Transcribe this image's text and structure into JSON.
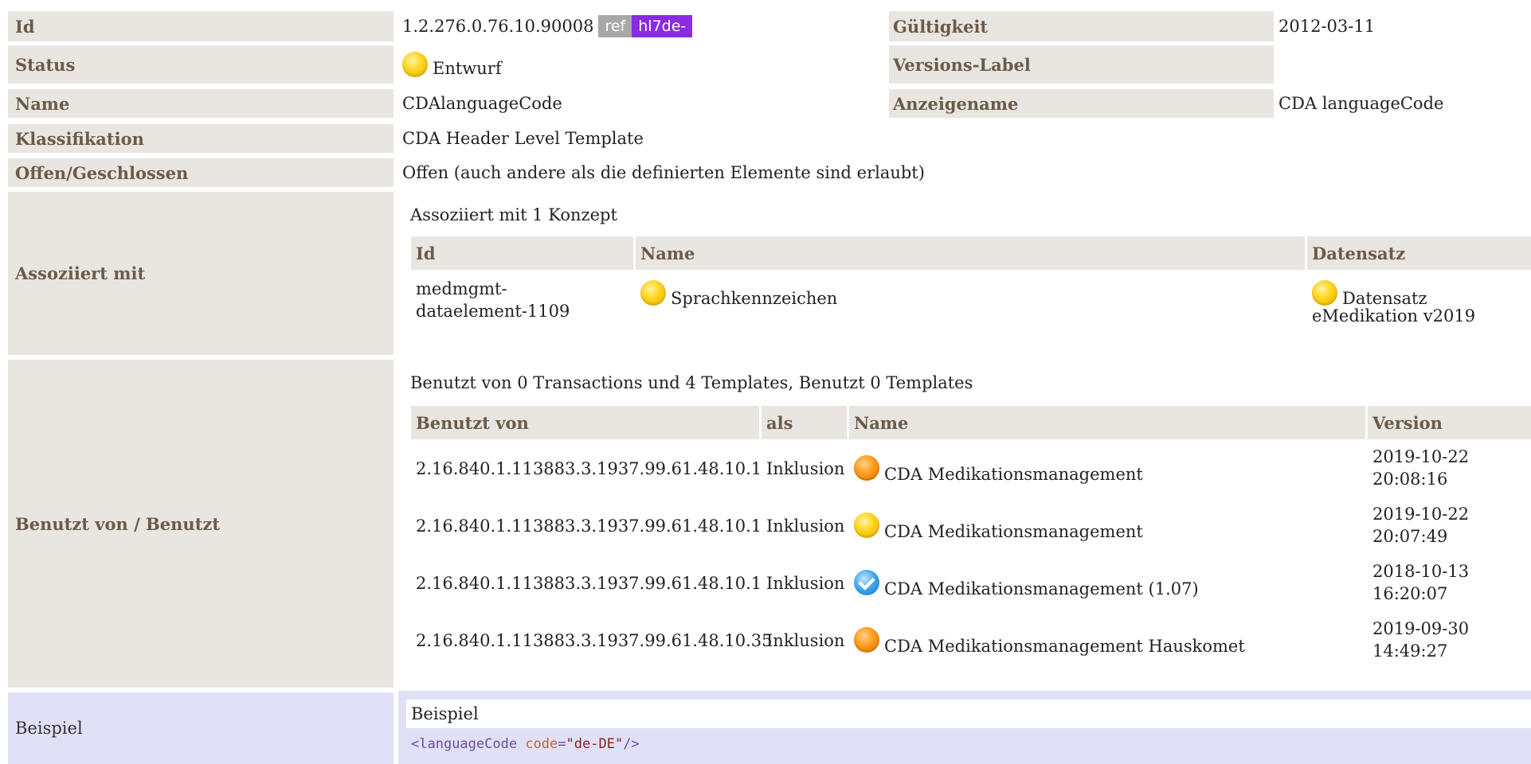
{
  "rows": {
    "id": {
      "label": "Id",
      "value": "1.2.276.0.76.10.90008",
      "badge_ref": "ref",
      "badge_hl7": "hl7de-"
    },
    "gueltigkeit": {
      "label": "Gültigkeit",
      "value": "2012-03-11"
    },
    "status": {
      "label": "Status",
      "value": "Entwurf",
      "icon": "status-draft-yellow"
    },
    "versions_label": {
      "label": "Versions-Label",
      "value": ""
    },
    "name": {
      "label": "Name",
      "value": "CDAlanguageCode"
    },
    "anzeigename": {
      "label": "Anzeigename",
      "value": "CDA languageCode"
    },
    "klassifikation": {
      "label": "Klassifikation",
      "value": "CDA Header Level Template"
    },
    "offen": {
      "label": "Offen/Geschlossen",
      "value": "Offen (auch andere als die definierten Elemente sind erlaubt)"
    }
  },
  "assoziiert": {
    "label": "Assoziiert mit",
    "summary": "Assoziiert mit 1 Konzept",
    "headers": [
      "Id",
      "Name",
      "Datensatz"
    ],
    "items": [
      {
        "id_line1": "medmgmt-",
        "id_line2": "dataelement-1109",
        "name": "Sprachkennzeichen",
        "datensatz_line1": "Datensatz",
        "datensatz_line2": "eMedikation v2019"
      }
    ]
  },
  "benutzt": {
    "label": "Benutzt von / Benutzt",
    "summary": "Benutzt von 0 Transactions und 4 Templates, Benutzt 0 Templates",
    "headers": [
      "Benutzt von",
      "als",
      "Name",
      "Version"
    ],
    "rows": [
      {
        "oid": "2.16.840.1.113883.3.1937.99.61.48.10.1",
        "als": "Inklusion",
        "name": "CDA Medikationsmanagement",
        "icon": "orange",
        "date": "2019-10-22",
        "time": "20:08:16"
      },
      {
        "oid": "2.16.840.1.113883.3.1937.99.61.48.10.1",
        "als": "Inklusion",
        "name": "CDA Medikationsmanagement",
        "icon": "yellow",
        "date": "2019-10-22",
        "time": "20:07:49"
      },
      {
        "oid": "2.16.840.1.113883.3.1937.99.61.48.10.1",
        "als": "Inklusion",
        "name": "CDA Medikationsmanagement (1.07)",
        "icon": "blue",
        "date": "2018-10-13",
        "time": "16:20:07"
      },
      {
        "oid": "2.16.840.1.113883.3.1937.99.61.48.10.35",
        "als": "Inklusion",
        "name": "CDA Medikationsmanagement Hauskomet",
        "icon": "orange",
        "date": "2019-09-30",
        "time": "14:49:27"
      }
    ]
  },
  "beispiel": {
    "label": "Beispiel",
    "header": "Beispiel",
    "code_open": "<",
    "code_tag": "languageCode",
    "code_attr": "code",
    "code_eq": "=",
    "code_val": "\"de-DE\"",
    "code_close": "/>"
  }
}
